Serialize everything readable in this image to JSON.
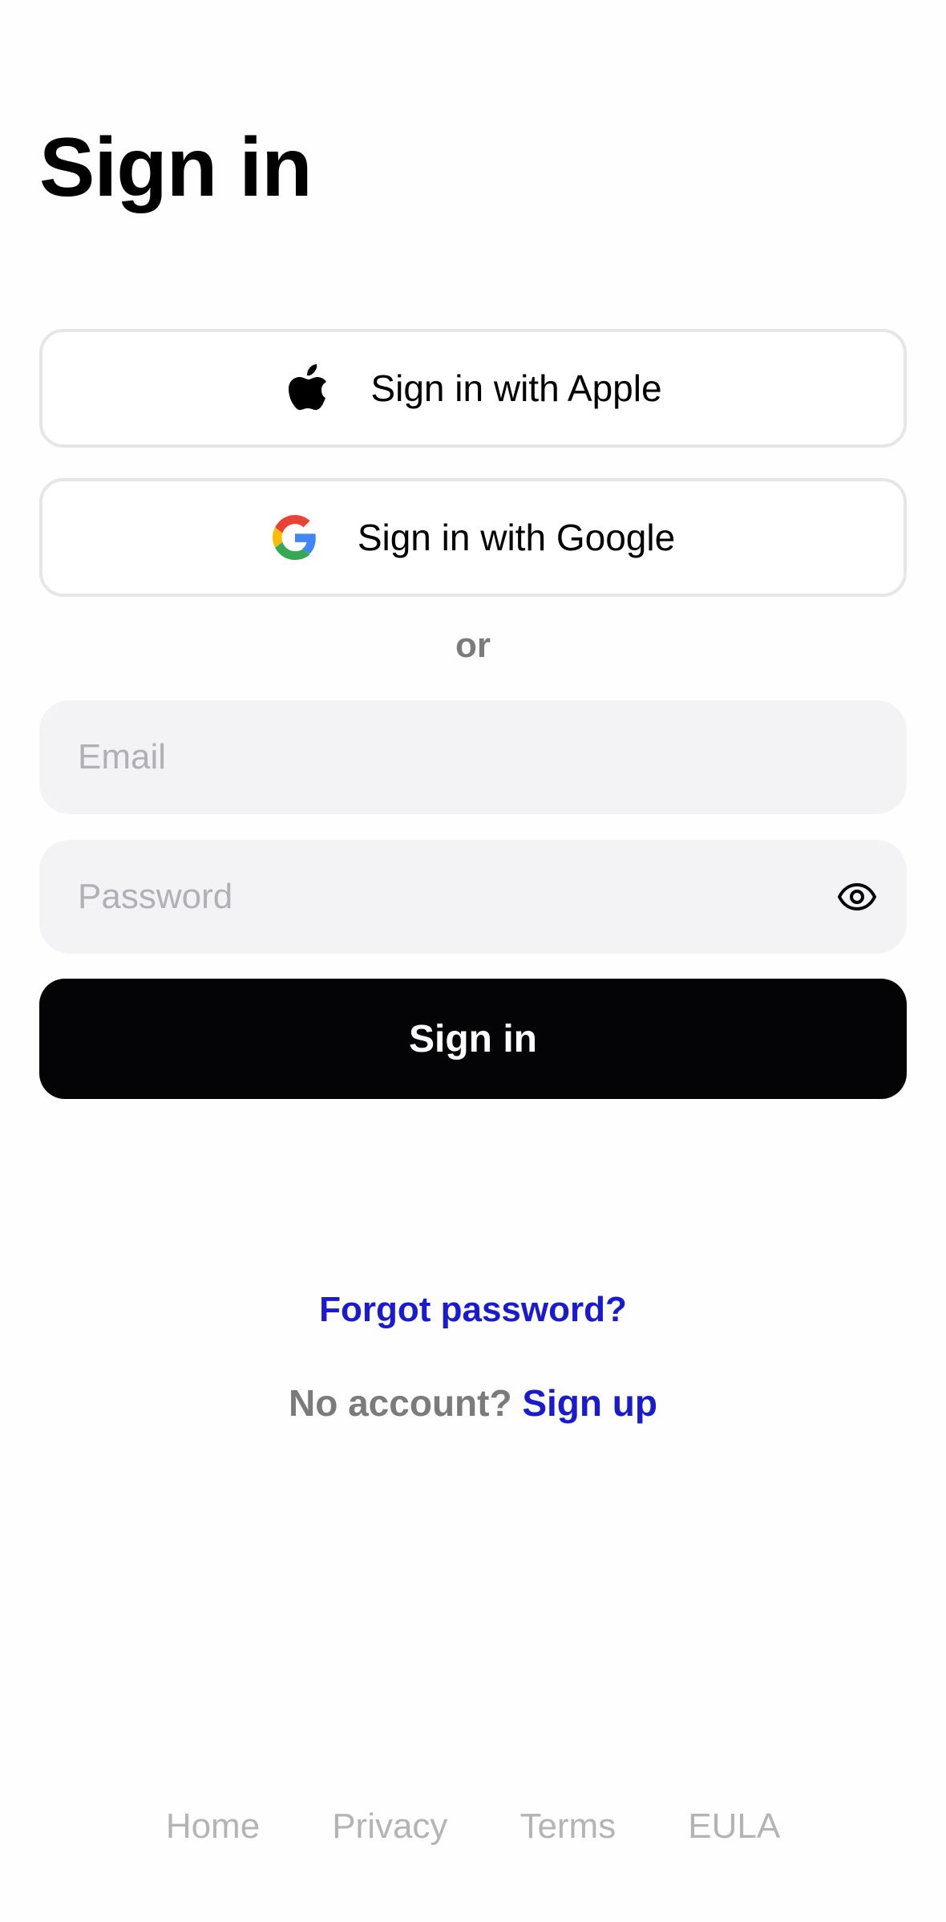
{
  "page": {
    "title": "Sign in"
  },
  "oauth": {
    "apple_label": "Sign in with Apple",
    "apple_icon": "apple-logo-icon",
    "google_label": "Sign in with Google",
    "google_icon": "google-logo-icon"
  },
  "divider": {
    "text": "or"
  },
  "form": {
    "email_value": "",
    "email_placeholder": "Email",
    "password_value": "",
    "password_placeholder": "Password",
    "password_toggle_icon": "eye-icon",
    "submit_label": "Sign in"
  },
  "links": {
    "forgot_password": "Forgot password?",
    "no_account_text": "No account?",
    "sign_up": "Sign up"
  },
  "footer": {
    "items": [
      "Home",
      "Privacy",
      "Terms",
      "EULA"
    ]
  },
  "colors": {
    "primary_button": "#040306",
    "link": "#1a1ad0",
    "muted_text": "#7b7b7b",
    "footer_text": "#b4b4b4",
    "field_background": "#f3f3f5",
    "border": "#e6e6e6"
  }
}
